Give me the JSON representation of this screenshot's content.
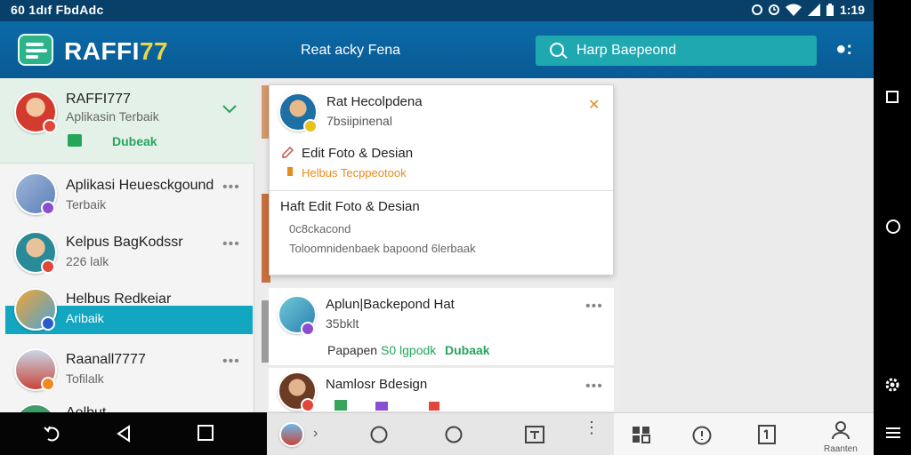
{
  "status_bar": {
    "left_text": "60 1dıf FbdAdc",
    "time": "1:19"
  },
  "app_bar": {
    "brand_prefix": "RAFFI",
    "brand_suffix": "77",
    "title": "Reat acky Fena",
    "search_text": "Harp Baepeond",
    "more": "●:"
  },
  "left_list": {
    "top_item": {
      "name": "RAFFI777",
      "sub": "Aplikasin Terbaik",
      "action": "Dubeak"
    },
    "items": [
      {
        "name": "Aplikasi Heuesckgound",
        "sub": "Terbaik"
      },
      {
        "name": "Kelpus BagKodssr",
        "sub": "226 lalk"
      },
      {
        "name": "Helbus Redkeiar",
        "sub": "Aribaik"
      },
      {
        "name": "Raanall7777",
        "sub": "Tofilalk"
      },
      {
        "name": "Aelbut",
        "sub": ""
      }
    ],
    "more_label": "•••"
  },
  "popup": {
    "title": "Rat Hecolpdena",
    "subtitle": "7bsiipinenal",
    "close_label": "✕",
    "menu1_label": "Edit Foto & Desian",
    "menu1_sub": "Helbus Tecppeotook",
    "section_title": "Haft Edit Foto & Desian",
    "line1": "0c8ckacond",
    "line2": "Toloomnidenbaek bapoond 6lerbaak"
  },
  "cards": [
    {
      "title": "Aplun|Backepond Hat",
      "sub": "35bklt",
      "meta": "Papapen",
      "meta2": "S0 lgpodk",
      "action": "Dubaak"
    },
    {
      "title": "Namlosr Bdesign"
    }
  ],
  "bottom_nav": {
    "profile_label": "Raanten"
  },
  "colors": {
    "status_bar": "#08406a",
    "app_bar": "#0b6aa8",
    "search": "#1fa8b0",
    "selected": "#12a6c1",
    "green_action": "#25a55a",
    "orange_accent": "#e78b1e"
  }
}
